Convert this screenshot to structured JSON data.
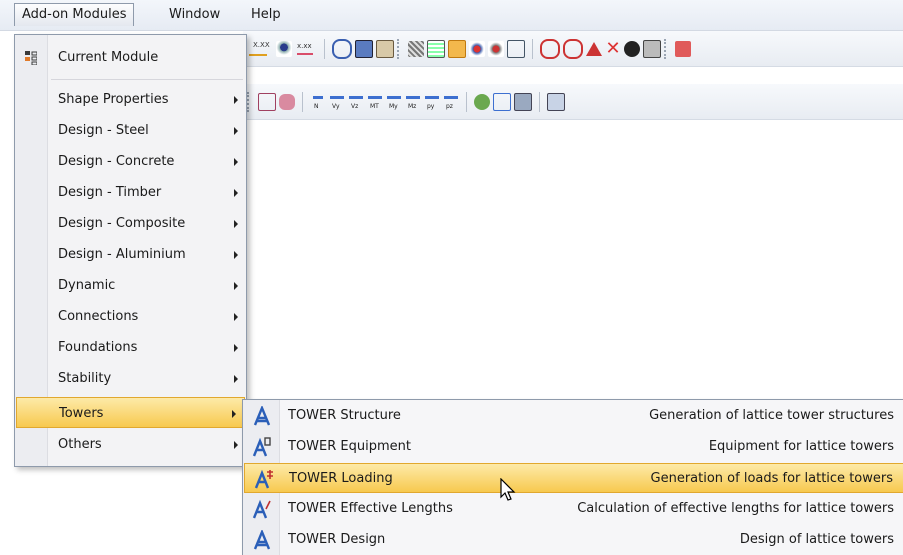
{
  "menubar": {
    "items": [
      {
        "label": "Add-on Modules",
        "active": true
      },
      {
        "label": "Window"
      },
      {
        "label": "Help"
      }
    ]
  },
  "dropdown": {
    "items": [
      {
        "label": "Current Module",
        "has_submenu": false,
        "icon": "module-icon"
      },
      {
        "label": "Shape Properties",
        "has_submenu": true
      },
      {
        "label": "Design - Steel",
        "has_submenu": true
      },
      {
        "label": "Design - Concrete",
        "has_submenu": true
      },
      {
        "label": "Design - Timber",
        "has_submenu": true
      },
      {
        "label": "Design - Composite",
        "has_submenu": true
      },
      {
        "label": "Design - Aluminium",
        "has_submenu": true
      },
      {
        "label": "Dynamic",
        "has_submenu": true
      },
      {
        "label": "Connections",
        "has_submenu": true
      },
      {
        "label": "Foundations",
        "has_submenu": true
      },
      {
        "label": "Stability",
        "has_submenu": true
      },
      {
        "label": "Towers",
        "has_submenu": true,
        "highlighted": true
      },
      {
        "label": "Others",
        "has_submenu": true
      }
    ]
  },
  "submenu": {
    "items": [
      {
        "label": "TOWER Structure",
        "description": "Generation of lattice tower structures",
        "icon": "tower-structure-icon"
      },
      {
        "label": "TOWER Equipment",
        "description": "Equipment for lattice towers",
        "icon": "tower-equipment-icon"
      },
      {
        "label": "TOWER Loading",
        "description": "Generation of loads for lattice towers",
        "icon": "tower-loading-icon",
        "highlighted": true
      },
      {
        "label": "TOWER Effective Lengths",
        "description": "Calculation of effective lengths for lattice towers",
        "icon": "tower-effective-lengths-icon"
      },
      {
        "label": "TOWER Design",
        "description": "Design of lattice towers",
        "icon": "tower-design-icon"
      }
    ]
  },
  "toolbar_text": {
    "xxx1": "X.XX",
    "xxx2": "x.xx",
    "res_n": "N",
    "res_vy": "Vy",
    "res_vz": "Vz",
    "res_mt": "MT",
    "res_my": "My",
    "res_mz": "Mz",
    "res_py": "py",
    "res_pz": "pz"
  },
  "colors": {
    "highlight_top": "#fdeaa8",
    "highlight_bottom": "#f7c94f",
    "menu_border": "#8e9aab",
    "icon_blue": "#2b5fb8"
  }
}
